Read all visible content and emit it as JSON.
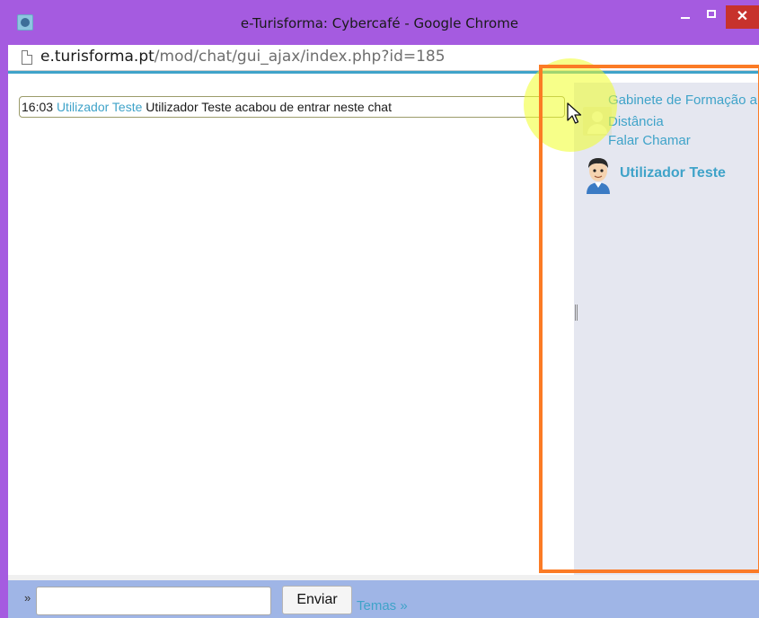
{
  "window": {
    "title": "e-Turisforma: Cybercafé - Google Chrome",
    "close_glyph": "✕"
  },
  "address_bar": {
    "domain": "e.turisforma.pt",
    "path": "/mod/chat/gui_ajax/index.php?id=185"
  },
  "chat": {
    "messages": [
      {
        "time": "16:03",
        "user": "Utilizador Teste",
        "text": "Utilizador Teste acabou de entrar neste chat"
      }
    ]
  },
  "sidebar": {
    "course_name": "Gabinete de Formação a Distância",
    "course_action": "Falar Chamar",
    "users": [
      {
        "name": "Utilizador Teste"
      }
    ]
  },
  "input_bar": {
    "prompt_glyph": "»",
    "input_value": "",
    "send_label": "Enviar",
    "themes_link": "Temas »"
  },
  "colors": {
    "window_frame": "#a55be0",
    "link": "#3fa3c9",
    "highlight_frame": "#fb7b25",
    "sidebar_bg": "#e5e7f0",
    "input_bar_bg": "#9fb5e6"
  },
  "icons": {
    "app": "moodle-app-icon",
    "page": "page-icon",
    "course_avatar": "default-user-icon",
    "user_avatar": "user-avatar-icon",
    "cursor": "mouse-pointer-icon"
  }
}
